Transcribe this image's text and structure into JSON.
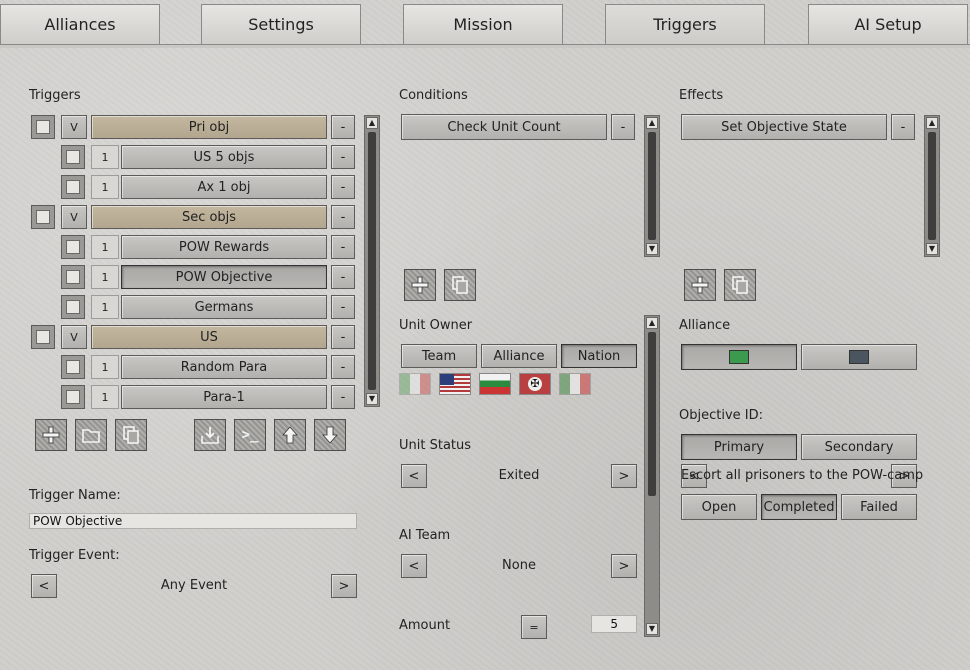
{
  "tabs": [
    "Alliances",
    "Settings",
    "Mission",
    "Triggers",
    "AI Setup"
  ],
  "triggers": {
    "heading": "Triggers",
    "items": [
      {
        "type": "group",
        "toggle": "V",
        "label": "Pri obj",
        "remove": "-"
      },
      {
        "type": "item",
        "count": "1",
        "label": "US 5 objs",
        "remove": "-"
      },
      {
        "type": "item",
        "count": "1",
        "label": "Ax 1 obj",
        "remove": "-"
      },
      {
        "type": "group",
        "toggle": "V",
        "label": "Sec objs",
        "remove": "-"
      },
      {
        "type": "item",
        "count": "1",
        "label": "POW Rewards",
        "remove": "-"
      },
      {
        "type": "item",
        "count": "1",
        "label": "POW Objective",
        "remove": "-",
        "selected": true
      },
      {
        "type": "item",
        "count": "1",
        "label": "Germans",
        "remove": "-"
      },
      {
        "type": "group",
        "toggle": "V",
        "label": "US",
        "remove": "-"
      },
      {
        "type": "item",
        "count": "1",
        "label": "Random Para",
        "remove": "-"
      },
      {
        "type": "item",
        "count": "1",
        "label": "Para-1",
        "remove": "-"
      }
    ],
    "toolbar": [
      "add-icon",
      "folder-icon",
      "copy-icon",
      "import-icon",
      "console-icon",
      "move-up-icon",
      "move-down-icon"
    ],
    "console_glyph": ">_",
    "name_label": "Trigger Name:",
    "name_value": "POW Objective",
    "event_label": "Trigger Event:",
    "event_value": "Any Event",
    "prev": "<",
    "next": ">"
  },
  "conditions": {
    "heading": "Conditions",
    "items": [
      {
        "label": "Check Unit Count",
        "remove": "-"
      }
    ],
    "unit_owner_label": "Unit Owner",
    "owner_buttons": [
      "Team",
      "Alliance",
      "Nation"
    ],
    "owner_selected": "Nation",
    "flags": [
      "italy-flag",
      "usa-flag",
      "bulgaria-flag",
      "germany-flag",
      "italy-royal-flag"
    ],
    "unit_status_label": "Unit Status",
    "unit_status_value": "Exited",
    "ai_team_label": "AI Team",
    "ai_team_value": "None",
    "amount_label": "Amount",
    "amount_op": "=",
    "amount_value": "5",
    "prev": "<",
    "next": ">"
  },
  "effects": {
    "heading": "Effects",
    "items": [
      {
        "label": "Set Objective State",
        "remove": "-"
      }
    ],
    "alliance_label": "Alliance",
    "alliance_colors": [
      "#3c9a4e",
      "#4a5560"
    ],
    "objective_id_label": "Objective ID:",
    "objective_types": [
      "Primary",
      "Secondary"
    ],
    "objective_type_selected": "Primary",
    "objective_text": "Escort all prisoners to the POW-camp",
    "states": [
      "Open",
      "Completed",
      "Failed"
    ],
    "state_selected": "Completed",
    "prev": "<",
    "next": ">"
  }
}
